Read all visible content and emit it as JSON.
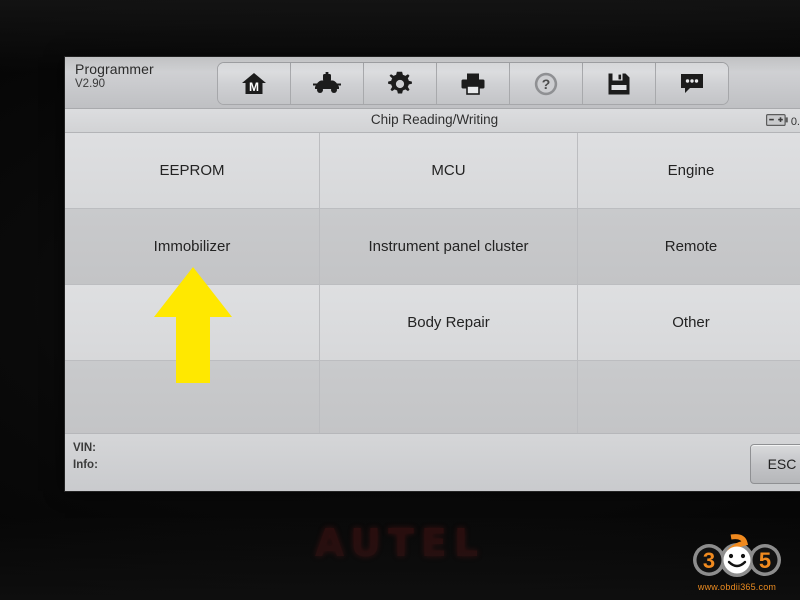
{
  "app": {
    "name": "Programmer",
    "version": "V2.90"
  },
  "toolbar": {
    "buttons": [
      {
        "name": "home-icon",
        "label": "Home"
      },
      {
        "name": "vehicle-icon",
        "label": "Vehicle"
      },
      {
        "name": "gear-icon",
        "label": "Settings"
      },
      {
        "name": "printer-icon",
        "label": "Print"
      },
      {
        "name": "help-icon",
        "label": "Help"
      },
      {
        "name": "save-icon",
        "label": "Save"
      },
      {
        "name": "message-icon",
        "label": "Feedback"
      }
    ]
  },
  "statusbar": {
    "page_title": "Chip Reading/Writing",
    "battery_icon": "battery-icon",
    "battery_level": "0."
  },
  "menu": {
    "rows": [
      {
        "shade": "light",
        "cells": [
          "EEPROM",
          "MCU",
          "Engine"
        ]
      },
      {
        "shade": "dark",
        "cells": [
          "Immobilizer",
          "Instrument panel cluster",
          "Remote"
        ]
      },
      {
        "shade": "light",
        "cells": [
          "",
          "Body Repair",
          "Other"
        ]
      },
      {
        "shade": "dark",
        "cells": [
          "",
          "",
          ""
        ]
      }
    ]
  },
  "infobar": {
    "vin_label": "VIN:",
    "info_label": "Info:",
    "esc_label": "ESC"
  },
  "annotation": {
    "arrow": "up-arrow-annotation",
    "color": "#FFE800"
  },
  "device": {
    "brand": "AUTEL"
  },
  "watermark": {
    "logo": "365",
    "site": "www.obdii365.com",
    "orange": "#f08a1f",
    "gray": "#8d8d8d"
  }
}
